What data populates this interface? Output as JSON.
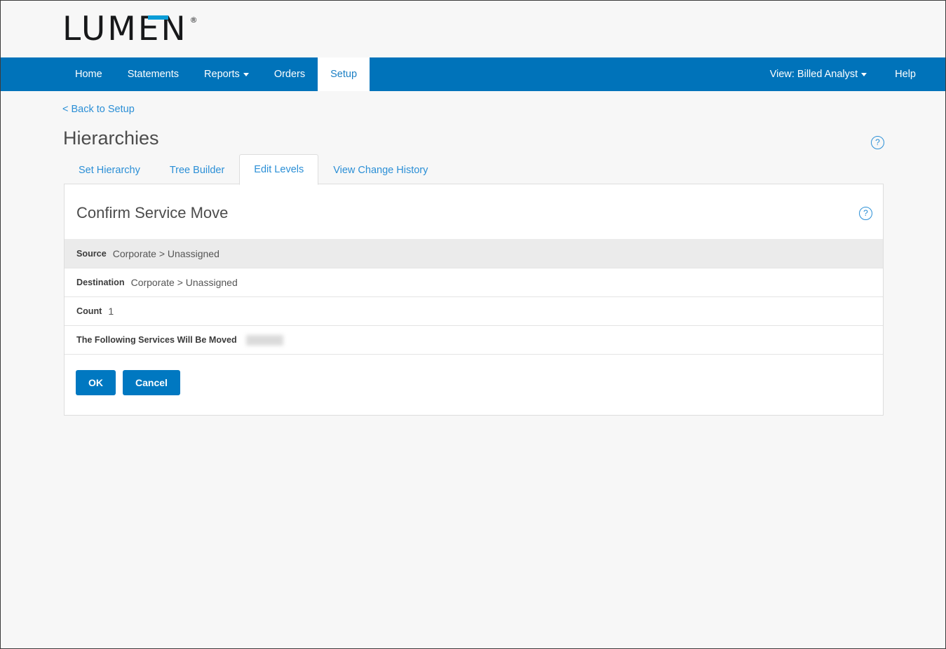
{
  "brand": {
    "logo_text": "LUMEN",
    "logo_registered": "®",
    "accent_color": "#0b9dd8",
    "nav_color": "#0073ba",
    "button_color": "#0078c1",
    "link_color": "#2b8fd6"
  },
  "nav": {
    "items": [
      {
        "label": "Home",
        "active": false
      },
      {
        "label": "Statements",
        "active": false
      },
      {
        "label": "Reports",
        "active": false,
        "caret": true
      },
      {
        "label": "Orders",
        "active": false
      },
      {
        "label": "Setup",
        "active": true
      }
    ],
    "view_selector": "View: Billed Analyst",
    "help": "Help"
  },
  "page": {
    "back_link": "< Back to Setup",
    "title": "Hierarchies",
    "help_icon": "?"
  },
  "tabs": [
    {
      "label": "Set Hierarchy",
      "active": false
    },
    {
      "label": "Tree Builder",
      "active": false
    },
    {
      "label": "Edit Levels",
      "active": true
    },
    {
      "label": "View Change History",
      "active": false
    }
  ],
  "panel": {
    "title": "Confirm Service Move",
    "help_icon": "?",
    "rows": [
      {
        "label": "Source",
        "value": "Corporate > Unassigned",
        "striped": true,
        "redacted": false
      },
      {
        "label": "Destination",
        "value": "Corporate > Unassigned",
        "striped": false,
        "redacted": false
      },
      {
        "label": "Count",
        "value": "1",
        "striped": false,
        "redacted": false
      },
      {
        "label": "The Following Services Will Be Moved",
        "value": "",
        "striped": false,
        "redacted": true
      }
    ],
    "buttons": [
      {
        "label": "OK",
        "name": "ok-button"
      },
      {
        "label": "Cancel",
        "name": "cancel-button"
      }
    ]
  }
}
